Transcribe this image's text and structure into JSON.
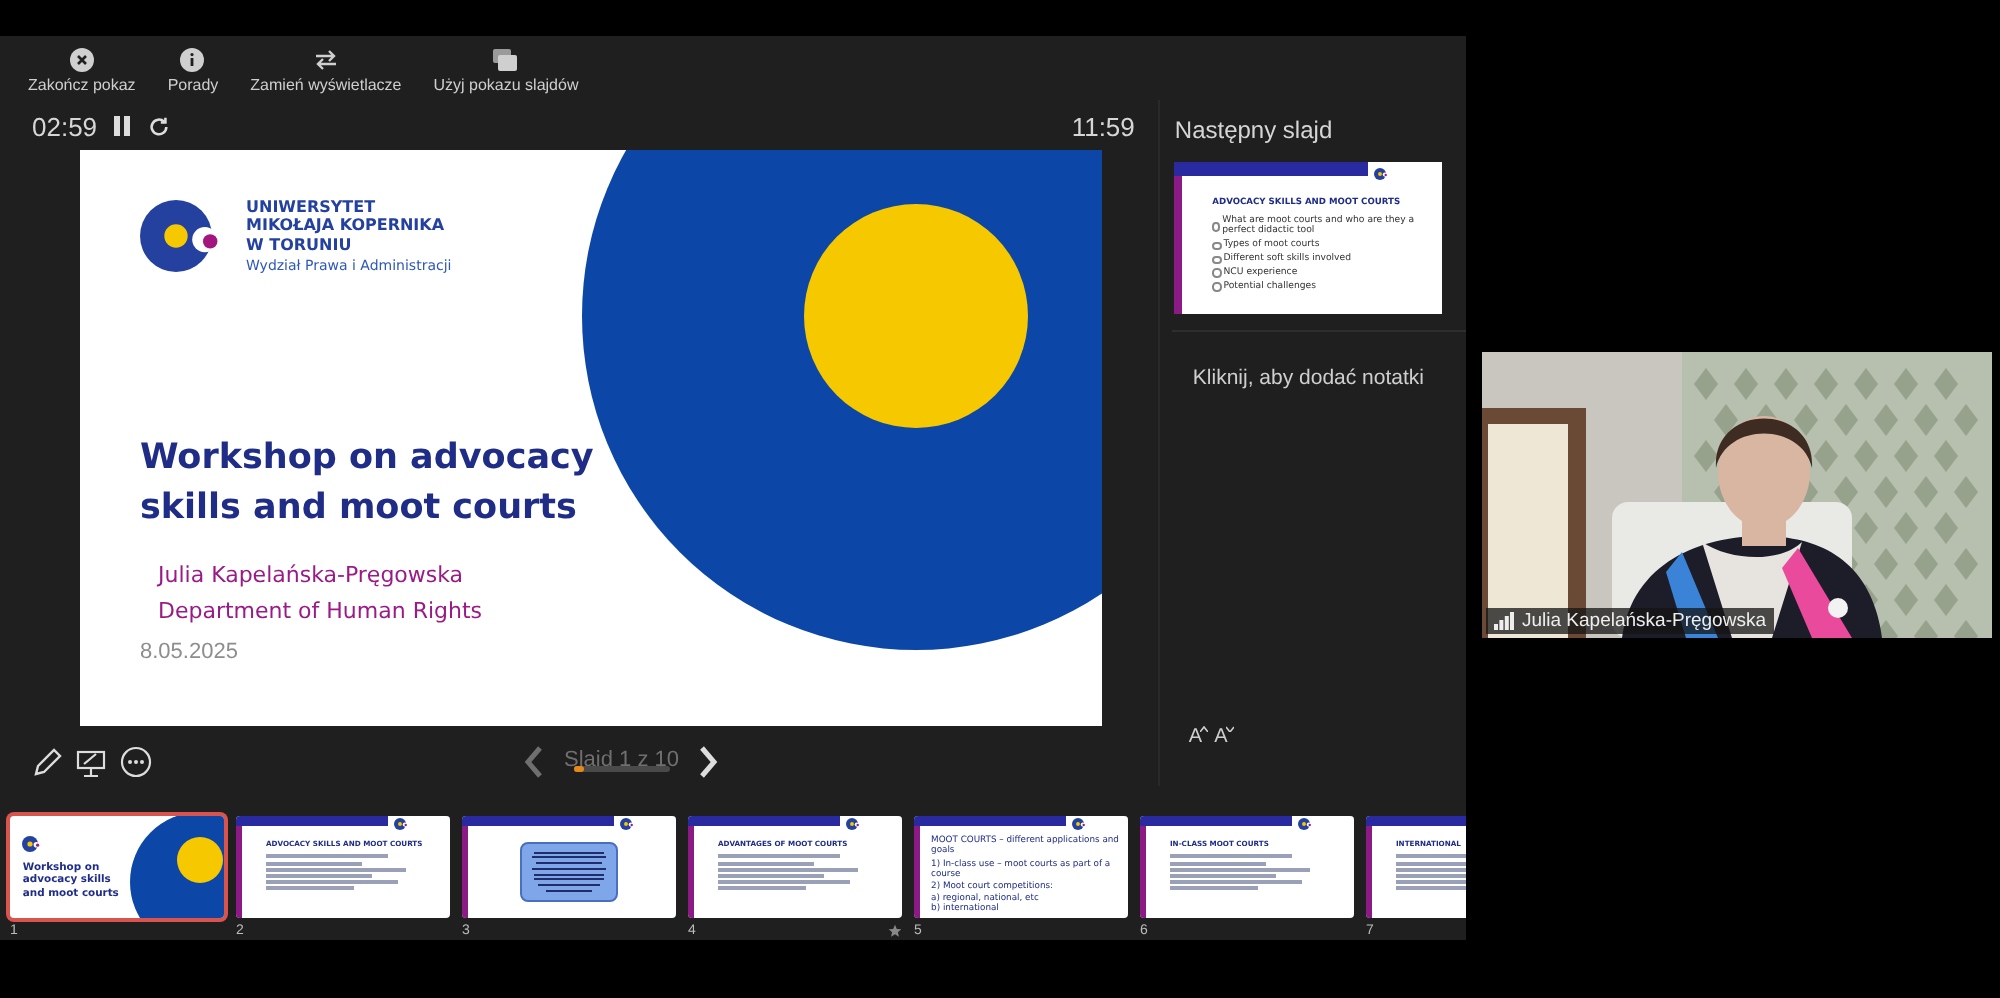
{
  "toolbar": [
    {
      "label": "Zakończ pokaz",
      "kind": "close"
    },
    {
      "label": "Porady",
      "kind": "info"
    },
    {
      "label": "Zamień wyświetlacze",
      "kind": "swap"
    },
    {
      "label": "Użyj pokazu slajdów",
      "kind": "slides"
    }
  ],
  "timer": {
    "elapsed": "02:59",
    "clock": "11:59"
  },
  "slide": {
    "university": [
      "UNIWERSYTET",
      "MIKOŁAJA KOPERNIKA",
      "W TORUNIU"
    ],
    "faculty": "Wydział Prawa i Administracji",
    "title": "Workshop on advocacy skills and moot courts",
    "author": "Julia Kapelańska-Pręgowska",
    "department": "Department of Human Rights",
    "date": "8.05.2025"
  },
  "next_slide": {
    "heading": "Następny slajd",
    "title": "ADVOCACY SKILLS AND MOOT COURTS",
    "bullets": [
      "What are moot courts and who are they a perfect didactic tool",
      "Types of moot courts",
      "Different soft skills involved",
      "NCU experience",
      "Potential challenges"
    ]
  },
  "notes": {
    "placeholder": "Kliknij, aby dodać notatki"
  },
  "navigation": {
    "label": "Slajd 1 z 10",
    "level": 0.1
  },
  "font_size_buttons": [
    {
      "label": "A",
      "kind": "increase"
    },
    {
      "label": "A",
      "kind": "decrease"
    }
  ],
  "thumbnails": [
    {
      "number": "1",
      "kind": "title",
      "selected": true,
      "starred": false,
      "title": "Workshop on advocacy skills and moot courts"
    },
    {
      "number": "2",
      "kind": "list",
      "selected": false,
      "starred": false,
      "title": "ADVOCACY SKILLS AND MOOT COURTS"
    },
    {
      "number": "3",
      "kind": "box",
      "selected": false,
      "starred": false
    },
    {
      "number": "4",
      "kind": "list",
      "selected": false,
      "starred": true,
      "title": "ADVANTAGES OF MOOT COURTS"
    },
    {
      "number": "5",
      "kind": "text",
      "selected": false,
      "starred": false,
      "title": "MOOT COURTS – different applications and goals",
      "lines": [
        "1) In-class use – moot courts as part of a course",
        "2) Moot court competitions:",
        "a) regional, national, etc",
        "b) international"
      ]
    },
    {
      "number": "6",
      "kind": "list",
      "selected": false,
      "starred": false,
      "title": "IN-CLASS MOOT COURTS"
    },
    {
      "number": "7",
      "kind": "list",
      "selected": false,
      "starred": false,
      "title": "INTERNATIONAL"
    }
  ],
  "video": {
    "participant": "Julia Kapelańska-Pręgowska"
  }
}
